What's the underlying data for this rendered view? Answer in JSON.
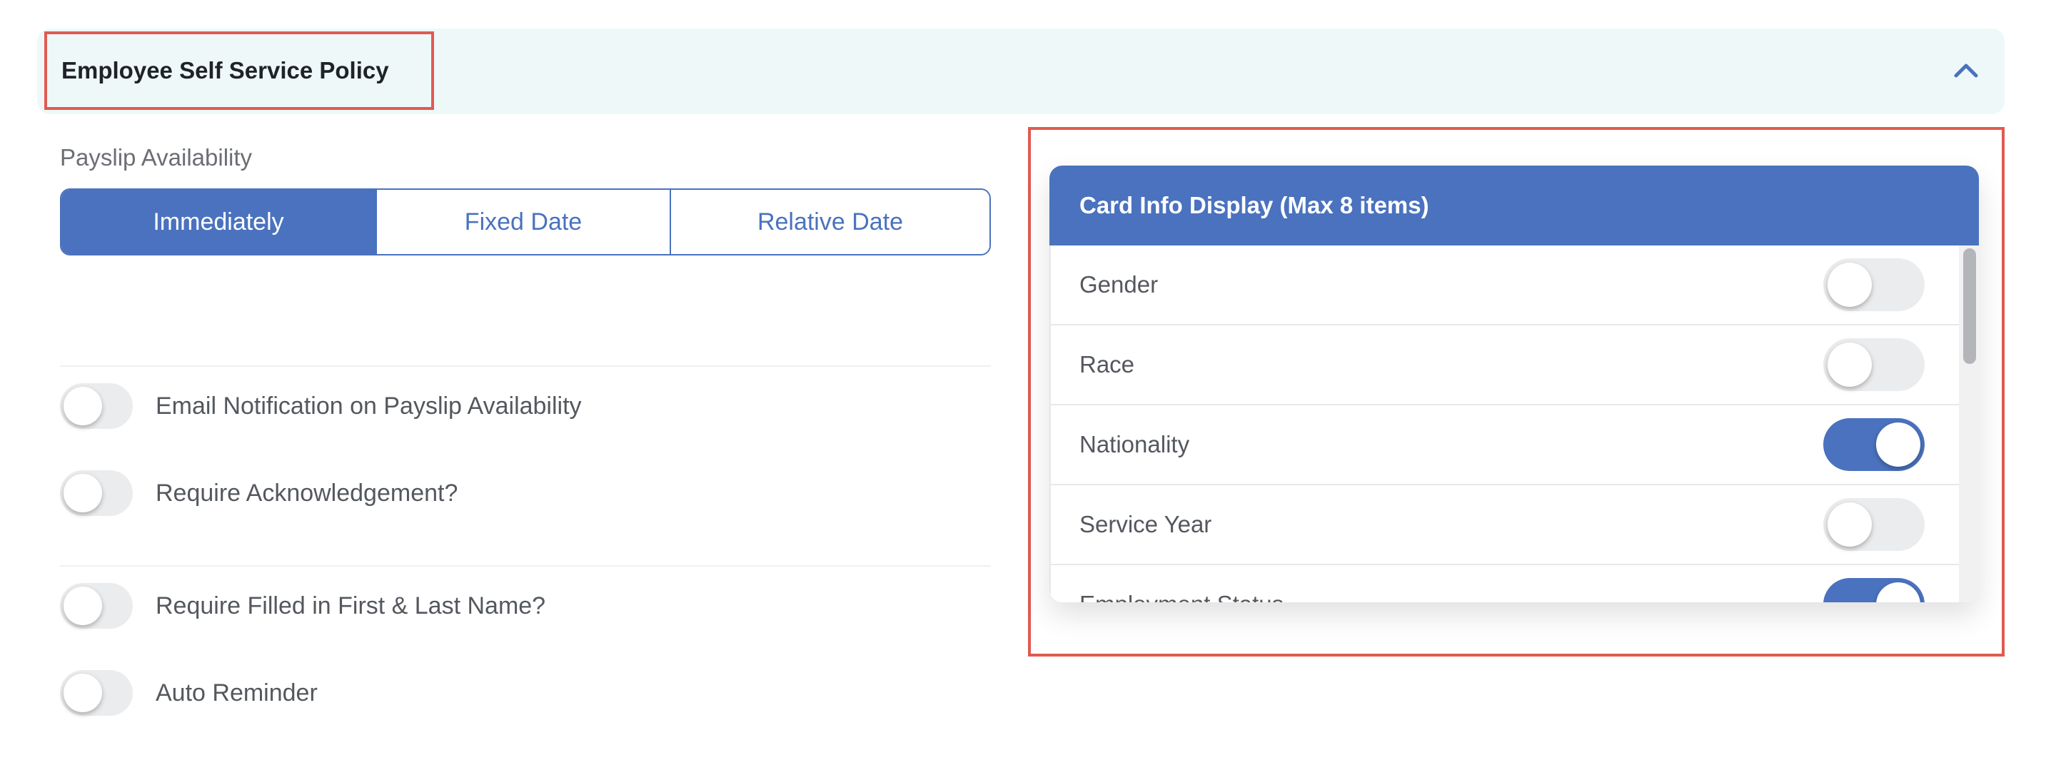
{
  "section": {
    "title": "Employee Self Service Policy"
  },
  "payslip": {
    "label": "Payslip Availability",
    "options": [
      "Immediately",
      "Fixed Date",
      "Relative Date"
    ],
    "selected": "Immediately"
  },
  "settings": [
    {
      "label": "Email Notification on Payslip Availability",
      "enabled": false
    },
    {
      "label": "Require Acknowledgement?",
      "enabled": false
    },
    {
      "label": "Require Filled in First & Last Name?",
      "enabled": false
    },
    {
      "label": "Auto Reminder",
      "enabled": false
    }
  ],
  "card_display": {
    "title": "Card Info Display (Max 8 items)",
    "items": [
      {
        "label": "Gender",
        "enabled": false
      },
      {
        "label": "Race",
        "enabled": false
      },
      {
        "label": "Nationality",
        "enabled": true
      },
      {
        "label": "Service Year",
        "enabled": false
      },
      {
        "label": "Employment Status",
        "enabled": true
      }
    ]
  },
  "colors": {
    "accent": "#4a72be",
    "header_bg": "#eef8f8",
    "highlight": "#e05a52"
  },
  "icons": {
    "collapse": "chevron-up-icon"
  }
}
